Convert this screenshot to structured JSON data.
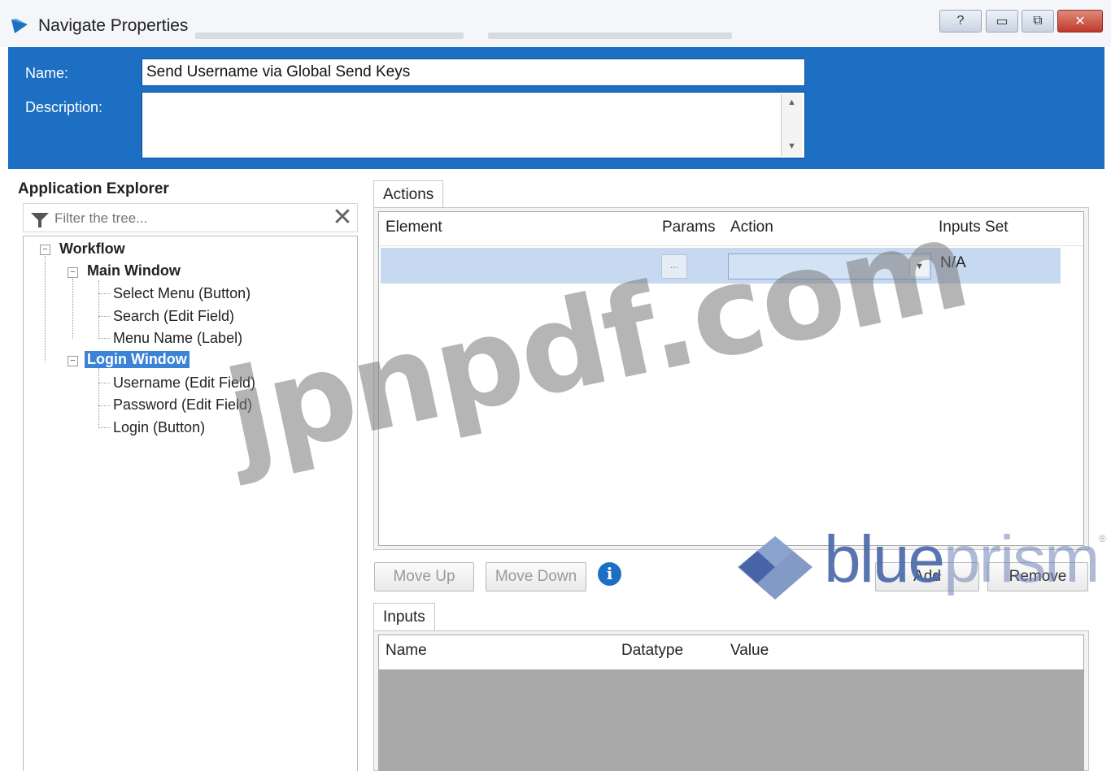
{
  "window": {
    "title": "Navigate Properties",
    "controls": {
      "help": "?",
      "minimize": "▭",
      "restore": "⧉",
      "close": "✕"
    }
  },
  "header": {
    "name_label": "Name:",
    "name_value": "Send Username via Global Send Keys",
    "description_label": "Description:",
    "description_value": ""
  },
  "app_explorer": {
    "title": "Application Explorer",
    "filter_placeholder": "Filter the tree...",
    "tree": {
      "root": "Workflow",
      "main_window": "Main Window",
      "main_children": [
        "Select Menu (Button)",
        "Search (Edit Field)",
        "Menu Name (Label)"
      ],
      "login_window": "Login Window",
      "login_children": [
        "Username (Edit Field)",
        "Password (Edit Field)",
        "Login (Button)"
      ]
    }
  },
  "actions": {
    "tab_label": "Actions",
    "columns": [
      "Element",
      "Params",
      "Action",
      "Inputs Set"
    ],
    "rows": [
      {
        "element": "",
        "params": "...",
        "action": "",
        "inputs_set": "N/A"
      }
    ]
  },
  "buttons": {
    "move_up": "Move Up",
    "move_down": "Move Down",
    "add": "Add",
    "remove": "Remove"
  },
  "inputs": {
    "tab_label": "Inputs",
    "columns": [
      "Name",
      "Datatype",
      "Value"
    ]
  },
  "overlays": {
    "watermark": "jpnpdf.com",
    "brand_part1": "blue",
    "brand_part2": "prism",
    "registered": "®"
  },
  "colors": {
    "header_blue": "#1c6fc2",
    "selection_blue": "#3b83d6",
    "row_highlight": "#c6d9f1",
    "inputs_body_gray": "#a9a9a9"
  },
  "icons": [
    "app-logo-icon",
    "filter-icon",
    "clear-filter-icon",
    "info-icon",
    "dropdown-arrow-icon",
    "collapse-icon"
  ]
}
